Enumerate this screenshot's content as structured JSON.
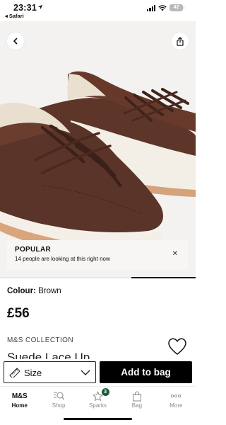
{
  "status_bar": {
    "time": "23:31",
    "back_app": "◂ Safari",
    "battery": "42"
  },
  "hero": {
    "back_icon": "chevron-left-icon",
    "share_icon": "share-icon",
    "gallery_progress": 0.33,
    "popular": {
      "title": "POPULAR",
      "text": "14 people are looking at this right now",
      "close_icon": "close-icon"
    }
  },
  "product": {
    "colour_label": "Colour:",
    "colour_value": "Brown",
    "price": "£56",
    "brand": "M&S COLLECTION",
    "name": "Suede Lace Up",
    "wishlist_icon": "heart-icon"
  },
  "actions": {
    "size_label": "Size",
    "size_icon": "ruler-icon",
    "add_to_bag": "Add to bag"
  },
  "tabbar": {
    "items": [
      {
        "logo": "M&S",
        "label": "Home",
        "active": true
      },
      {
        "label": "Shop",
        "icon": "search-icon"
      },
      {
        "label": "Sparks",
        "icon": "star-icon",
        "badge": "3"
      },
      {
        "label": "Bag",
        "icon": "bag-icon"
      },
      {
        "label": "More",
        "icon": "more-icon"
      }
    ]
  },
  "colors": {
    "accent": "#000000",
    "badge": "#1b5e3b",
    "shoe": "#5a3428",
    "sole": "#f1ece4"
  }
}
